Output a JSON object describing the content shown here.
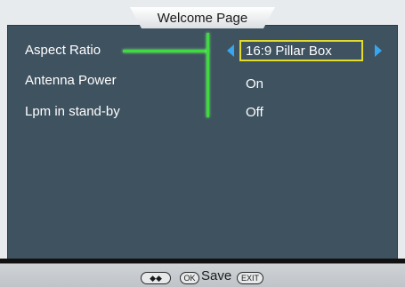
{
  "header": {
    "title": "Welcome Page"
  },
  "settings": [
    {
      "label": "Aspect Ratio",
      "value": "16:9 Pillar Box"
    },
    {
      "label": "Antenna Power",
      "value": "On"
    },
    {
      "label": "Lpm in stand-by",
      "value": "Off"
    }
  ],
  "footer": {
    "nav_hint": "◆◆",
    "ok_hint": "OK",
    "save_label": "Save",
    "exit_hint": "EXIT"
  },
  "colors": {
    "panel": "#3f5260",
    "highlight_line": "#3ddc3d",
    "selection_border": "#e3dc2a",
    "arrow": "#37a6ef"
  }
}
